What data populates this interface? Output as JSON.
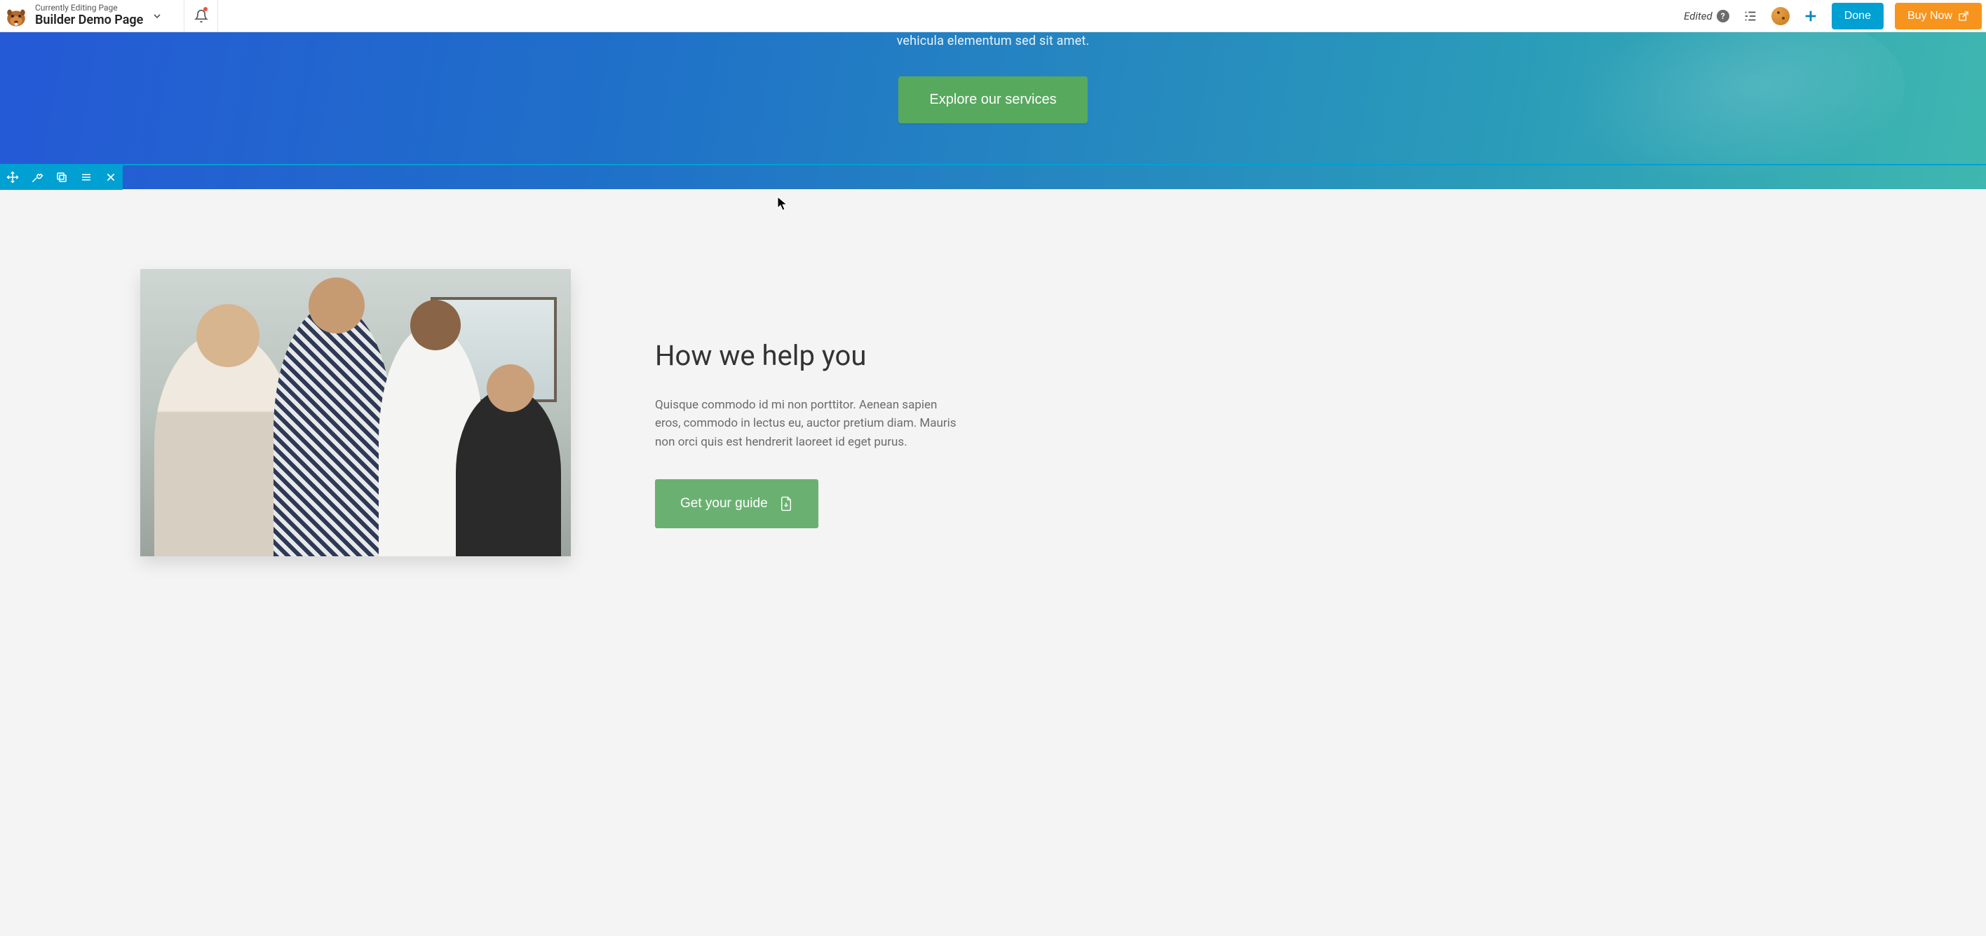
{
  "topbar": {
    "eyebrow": "Currently Editing Page",
    "page_title": "Builder Demo Page",
    "edited_label": "Edited",
    "done_label": "Done",
    "buy_label": "Buy Now"
  },
  "hero": {
    "subtext": "vehicula elementum sed sit amet.",
    "cta_label": "Explore our services"
  },
  "content": {
    "heading": "How we help you",
    "body": "Quisque commodo id mi non porttitor. Aenean sapien eros, commodo in lectus eu, auctor pretium diam. Mauris non orci quis est hendrerit laoreet id eget purus.",
    "guide_label": "Get your guide"
  },
  "colors": {
    "primary_blue": "#00a0d2",
    "orange": "#f7941e",
    "green": "#57a95e",
    "green_light": "#6ab171"
  }
}
